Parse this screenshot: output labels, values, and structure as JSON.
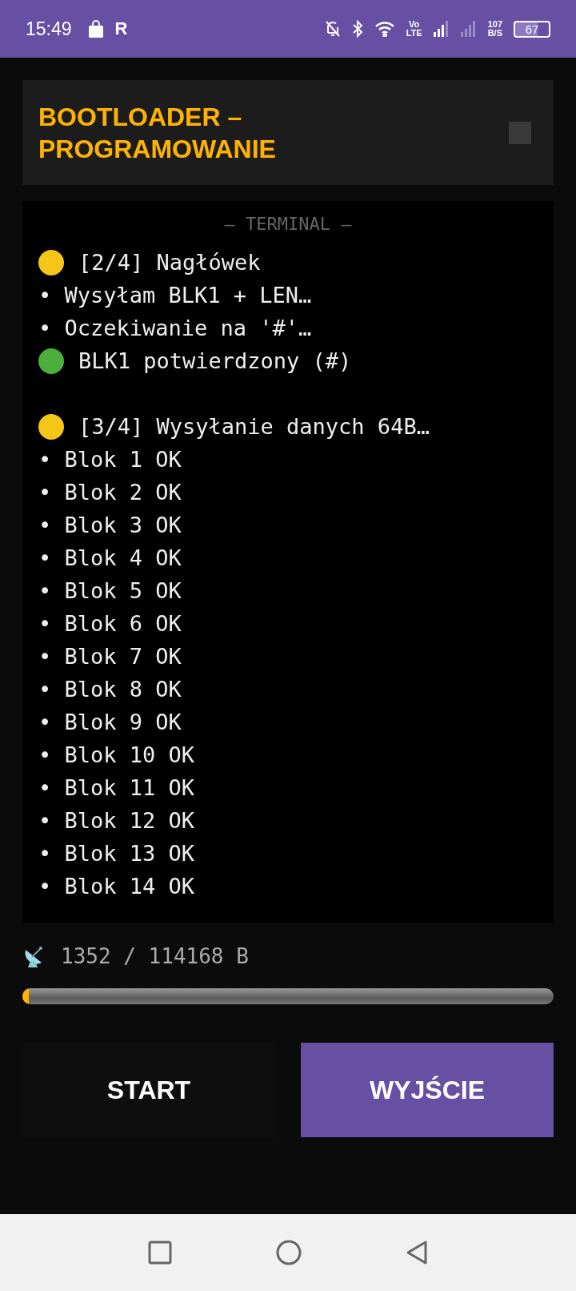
{
  "status_bar": {
    "time": "15:49",
    "app_letter": "R",
    "volte": [
      "Vo",
      "LTE"
    ],
    "speed": [
      "107",
      "B/S"
    ],
    "battery": "67"
  },
  "header": {
    "title": "BOOTLOADER – PROGRAMOWANIE"
  },
  "terminal": {
    "title": "— TERMINAL —",
    "lines": [
      {
        "kind": "status",
        "color": "#f5c518",
        "text": "[2/4] Nagłówek"
      },
      {
        "kind": "bullet",
        "text": "• Wysyłam BLK1 + LEN…"
      },
      {
        "kind": "bullet",
        "text": "• Oczekiwanie na '#'…"
      },
      {
        "kind": "status",
        "color": "#4caf3c",
        "text": "BLK1 potwierdzony (#)"
      },
      {
        "kind": "blank"
      },
      {
        "kind": "status",
        "color": "#f5c518",
        "text": "[3/4] Wysyłanie danych 64B…"
      },
      {
        "kind": "bullet",
        "text": "• Blok 1 OK"
      },
      {
        "kind": "bullet",
        "text": "• Blok 2 OK"
      },
      {
        "kind": "bullet",
        "text": "• Blok 3 OK"
      },
      {
        "kind": "bullet",
        "text": "• Blok 4 OK"
      },
      {
        "kind": "bullet",
        "text": "• Blok 5 OK"
      },
      {
        "kind": "bullet",
        "text": "• Blok 6 OK"
      },
      {
        "kind": "bullet",
        "text": "• Blok 7 OK"
      },
      {
        "kind": "bullet",
        "text": "• Blok 8 OK"
      },
      {
        "kind": "bullet",
        "text": "• Blok 9 OK"
      },
      {
        "kind": "bullet",
        "text": "• Blok 10 OK"
      },
      {
        "kind": "bullet",
        "text": "• Blok 11 OK"
      },
      {
        "kind": "bullet",
        "text": "• Blok 12 OK"
      },
      {
        "kind": "bullet",
        "text": "• Blok 13 OK"
      },
      {
        "kind": "bullet",
        "text": "• Blok 14 OK"
      }
    ]
  },
  "progress": {
    "reading": "1352 / 114168 B",
    "level": 0.012
  },
  "buttons": [
    {
      "label": "START",
      "kind": "dark"
    },
    {
      "label": "WYJŚCIE",
      "kind": "primary"
    }
  ]
}
